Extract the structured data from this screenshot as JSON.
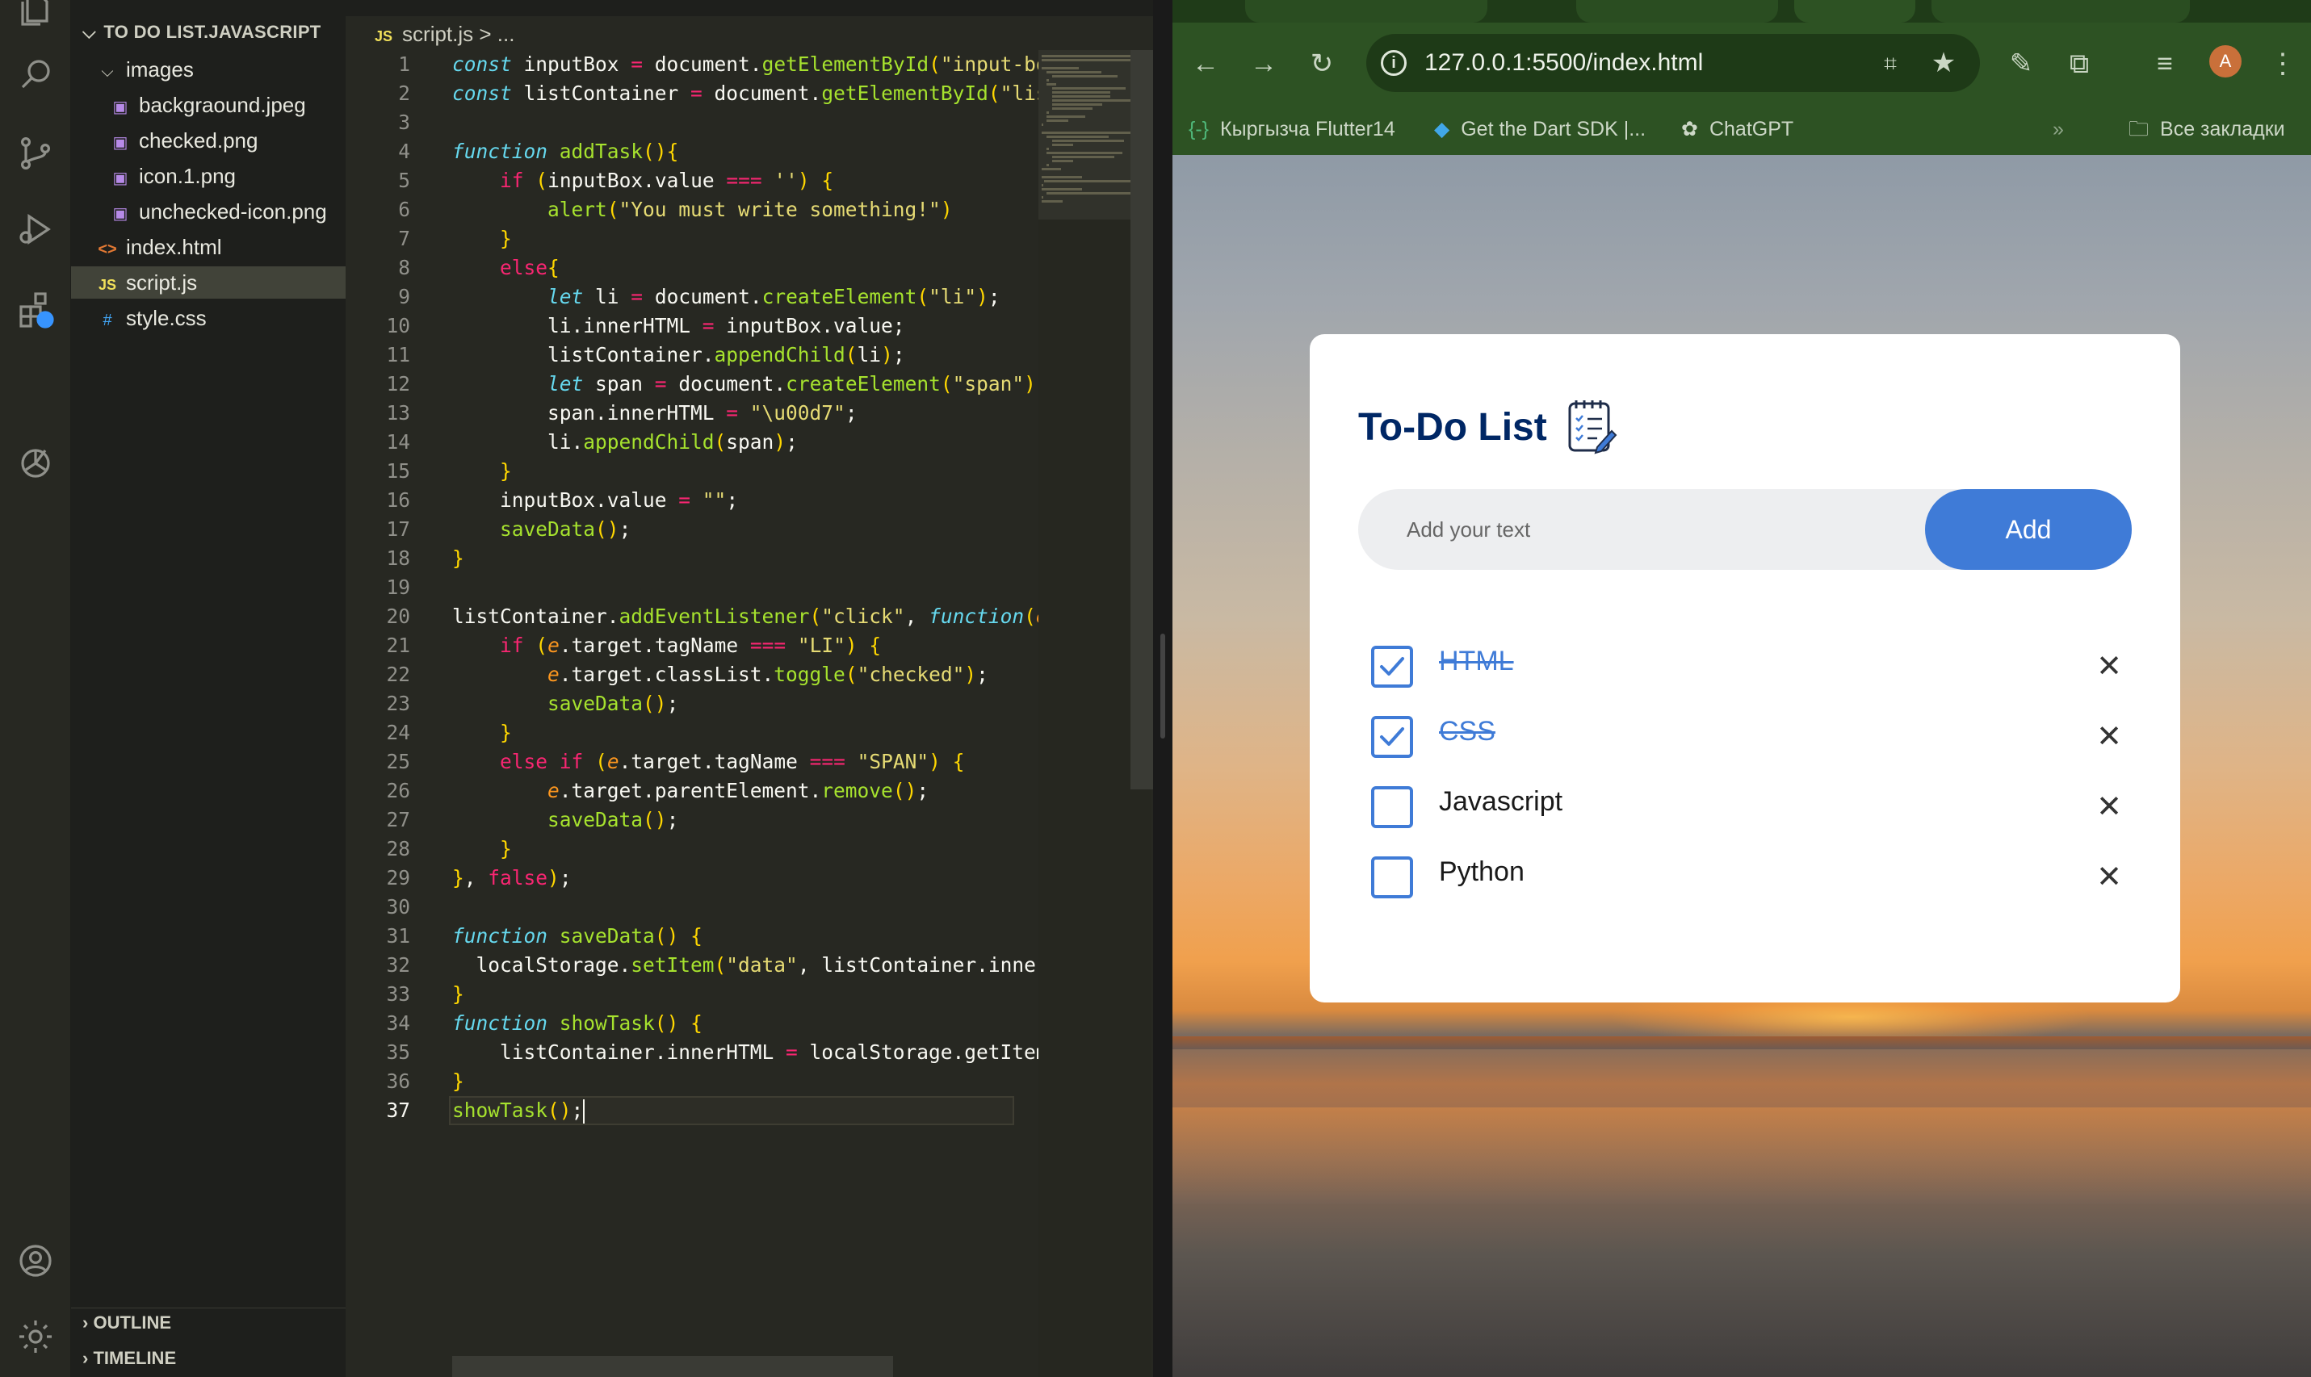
{
  "vscode": {
    "explorer_title": "TO DO LIST.JAVASCRIPT",
    "tree": [
      {
        "label": "images",
        "kind": "folder"
      },
      {
        "label": "backgraound.jpeg",
        "kind": "image"
      },
      {
        "label": "checked.png",
        "kind": "image"
      },
      {
        "label": "icon.1.png",
        "kind": "image"
      },
      {
        "label": "unchecked-icon.png",
        "kind": "image"
      },
      {
        "label": "index.html",
        "kind": "html"
      },
      {
        "label": "script.js",
        "kind": "js",
        "selected": true
      },
      {
        "label": "style.css",
        "kind": "css"
      }
    ],
    "sections": {
      "outline": "OUTLINE",
      "timeline": "TIMELINE"
    },
    "breadcrumb": {
      "file": "script.js",
      "rest": "> ..."
    },
    "activity_icons": [
      "files-icon",
      "search-icon",
      "source-control-icon",
      "run-debug-icon",
      "extensions-icon",
      "chatgpt-icon",
      "account-icon",
      "settings-gear-icon"
    ],
    "current_line": 37,
    "code_lines": [
      "const inputBox = document.getElementById(\"input-bo",
      "const listContainer = document.getElementById(\"lis",
      "",
      "function addTask(){",
      "    if (inputBox.value === '') {",
      "        alert(\"You must write something!\")",
      "    }",
      "    else{",
      "        let li = document.createElement(\"li\");",
      "        li.innerHTML = inputBox.value;",
      "        listContainer.appendChild(li);",
      "        let span = document.createElement(\"span\");",
      "        span.innerHTML = \"\\u00d7\";",
      "        li.appendChild(span);",
      "    }",
      "    inputBox.value = \"\";",
      "    saveData();",
      "}",
      "",
      "listContainer.addEventListener(\"click\", function(e",
      "    if (e.target.tagName === \"LI\") {",
      "        e.target.classList.toggle(\"checked\");",
      "        saveData();",
      "    }",
      "    else if (e.target.tagName === \"SPAN\") {",
      "        e.target.parentElement.remove();",
      "        saveData();",
      "    }",
      "}, false);",
      "",
      "function saveData() {",
      "  localStorage.setItem(\"data\", listContainer.inner",
      "}",
      "function showTask() {",
      "    listContainer.innerHTML = localStorage.getItem",
      "}",
      "showTask();"
    ]
  },
  "browser": {
    "url": "127.0.0.1:5500/index.html",
    "bookmarks": [
      "Кыргызча Flutter14",
      "Get the Dart SDK |...",
      "ChatGPT"
    ],
    "bookmarks_overflow": "»",
    "all_bookmarks": "Все закладки",
    "avatar_letter": "A",
    "app": {
      "title": "To-Do List",
      "input_placeholder": "Add your text",
      "add_label": "Add",
      "tasks": [
        {
          "text": "HTML",
          "checked": true
        },
        {
          "text": "CSS",
          "checked": true
        },
        {
          "text": "Javascript",
          "checked": false
        },
        {
          "text": "Python",
          "checked": false
        }
      ],
      "delete_glyph": "✕",
      "accent_color": "#3f7bd7",
      "title_color": "#002765"
    }
  }
}
